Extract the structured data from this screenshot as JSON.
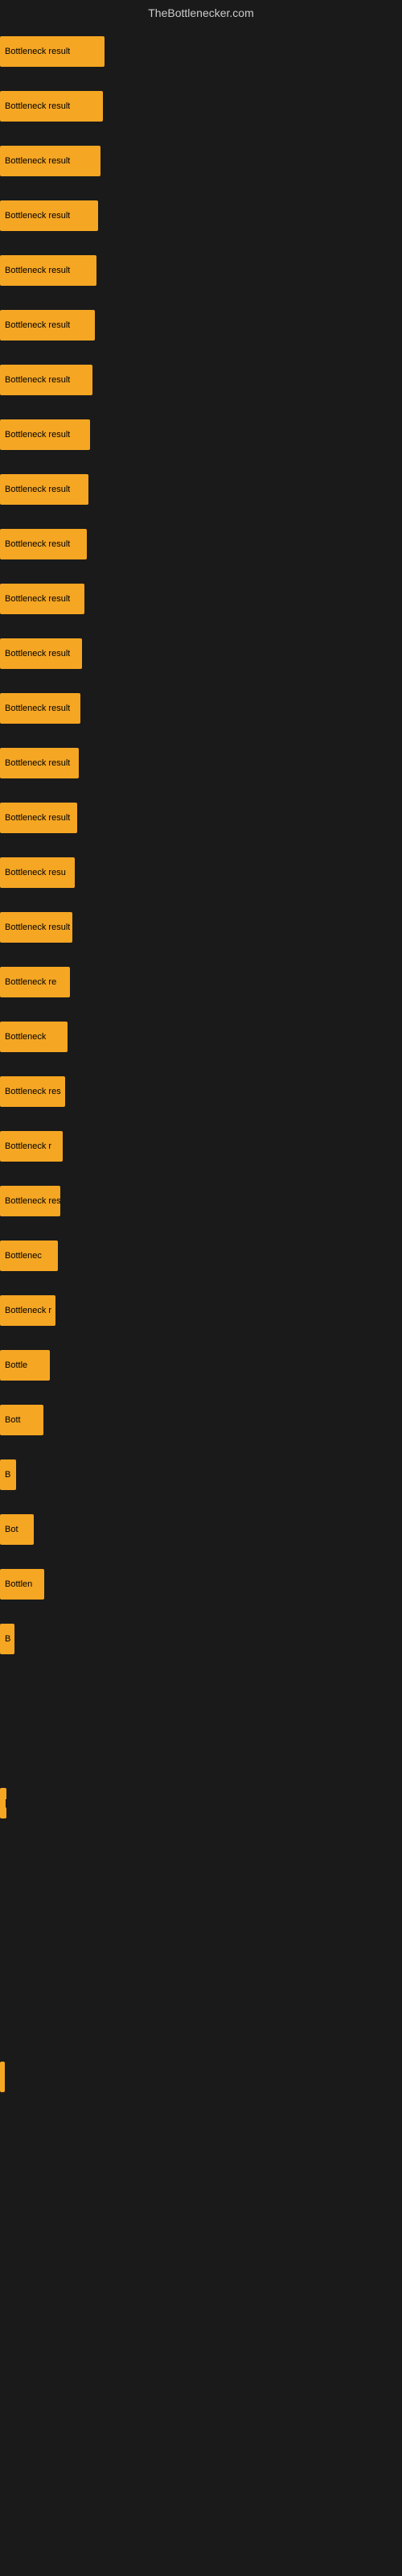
{
  "site": {
    "title": "TheBottlenecker.com"
  },
  "bars": [
    {
      "label": "Bottleneck result",
      "width": 130
    },
    {
      "label": "Bottleneck result",
      "width": 128
    },
    {
      "label": "Bottleneck result",
      "width": 125
    },
    {
      "label": "Bottleneck result",
      "width": 122
    },
    {
      "label": "Bottleneck result",
      "width": 120
    },
    {
      "label": "Bottleneck result",
      "width": 118
    },
    {
      "label": "Bottleneck result",
      "width": 115
    },
    {
      "label": "Bottleneck result",
      "width": 112
    },
    {
      "label": "Bottleneck result",
      "width": 110
    },
    {
      "label": "Bottleneck result",
      "width": 108
    },
    {
      "label": "Bottleneck result",
      "width": 105
    },
    {
      "label": "Bottleneck result",
      "width": 102
    },
    {
      "label": "Bottleneck result",
      "width": 100
    },
    {
      "label": "Bottleneck result",
      "width": 98
    },
    {
      "label": "Bottleneck result",
      "width": 96
    },
    {
      "label": "Bottleneck resu",
      "width": 93
    },
    {
      "label": "Bottleneck result",
      "width": 90
    },
    {
      "label": "Bottleneck re",
      "width": 87
    },
    {
      "label": "Bottleneck",
      "width": 84
    },
    {
      "label": "Bottleneck res",
      "width": 81
    },
    {
      "label": "Bottleneck r",
      "width": 78
    },
    {
      "label": "Bottleneck resu",
      "width": 75
    },
    {
      "label": "Bottlenec",
      "width": 72
    },
    {
      "label": "Bottleneck r",
      "width": 69
    },
    {
      "label": "Bottle",
      "width": 62
    },
    {
      "label": "Bott",
      "width": 54
    },
    {
      "label": "B",
      "width": 20
    },
    {
      "label": "Bot",
      "width": 42
    },
    {
      "label": "Bottlen",
      "width": 55
    },
    {
      "label": "B",
      "width": 18
    },
    {
      "label": "",
      "width": 0
    },
    {
      "label": "",
      "width": 0
    },
    {
      "label": "|",
      "width": 8
    },
    {
      "label": "",
      "width": 0
    },
    {
      "label": "",
      "width": 0
    },
    {
      "label": "",
      "width": 0
    },
    {
      "label": "",
      "width": 0
    },
    {
      "label": "",
      "width": 6
    }
  ]
}
